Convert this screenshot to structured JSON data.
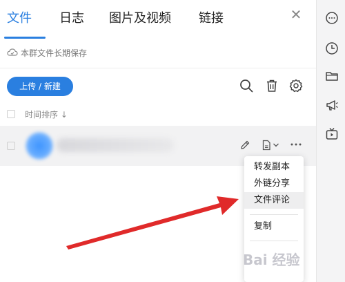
{
  "tabs": [
    {
      "label": "文件",
      "active": true
    },
    {
      "label": "日志",
      "active": false
    },
    {
      "label": "图片及视频",
      "active": false
    },
    {
      "label": "链接",
      "active": false
    }
  ],
  "info_text": "本群文件长期保存",
  "upload_button": "上传 / 新建",
  "sort_label": "时间排序 ↓",
  "context_menu": {
    "items": [
      "转发副本",
      "外链分享",
      "文件评论",
      "复制"
    ],
    "highlighted": "文件评论"
  },
  "watermark": "Bai 经验",
  "colors": {
    "accent": "#2a7fe0",
    "annotation_arrow": "#e02a2a"
  },
  "right_sidebar_icons": [
    "chat-bubble-icon",
    "clock-icon",
    "folder-icon",
    "megaphone-icon",
    "tv-icon"
  ]
}
